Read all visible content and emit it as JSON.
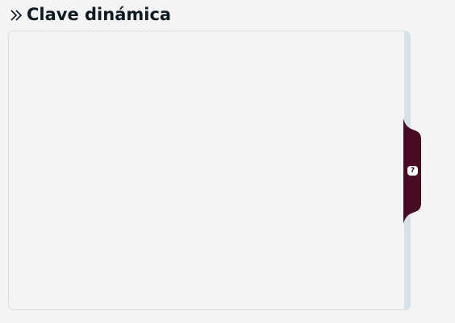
{
  "header": {
    "icon": "double-chevron-right-icon",
    "title": "Clave dinámica"
  },
  "help_tab": {
    "icon": "question-icon",
    "icon_glyph": "?"
  },
  "colors": {
    "background": "#f4f4f4",
    "title": "#0f1b23",
    "panel_border": "#d8e2e4",
    "rail": "#d4e3e7",
    "help_tab": "#470c24"
  }
}
